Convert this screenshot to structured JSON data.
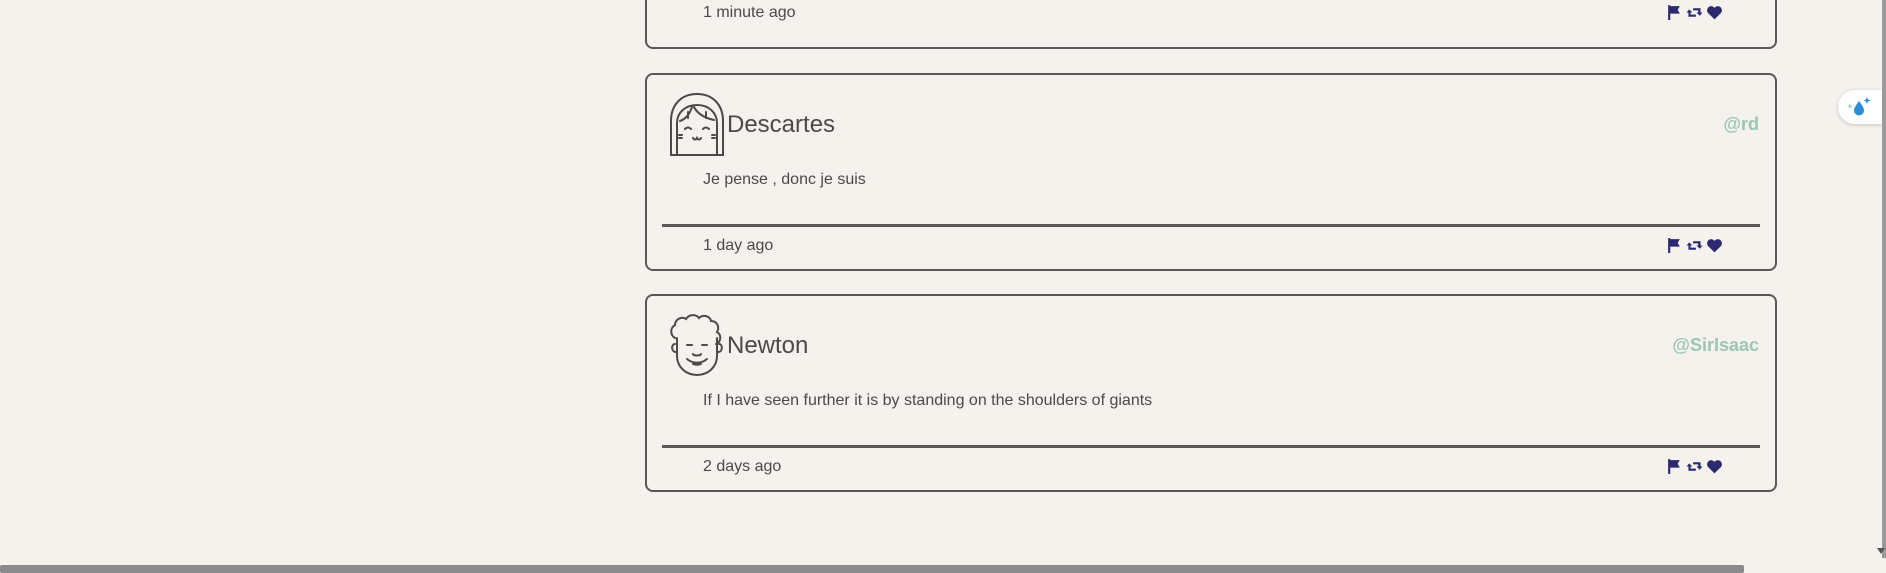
{
  "tweets": [
    {
      "name": "",
      "handle": "",
      "text": "",
      "time": "1 minute ago"
    },
    {
      "name": "Descartes",
      "handle": "@rd",
      "text": "Je pense , donc je suis",
      "time": "1 day ago"
    },
    {
      "name": "Newton",
      "handle": "@SirIsaac",
      "text": "If I have seen further it is by standing on the shoulders of giants",
      "time": "2 days ago"
    }
  ],
  "icons": {
    "flag": "flag-icon",
    "retweet": "retweet-icon",
    "heart": "heart-icon",
    "widget": "water-drop-sparkle-icon"
  },
  "colors": {
    "background": "#f5f1ec",
    "border": "#5b5757",
    "handle": "#9cc6b4",
    "action_icons": "#2b2a6e",
    "text": "#4a4a4a"
  }
}
